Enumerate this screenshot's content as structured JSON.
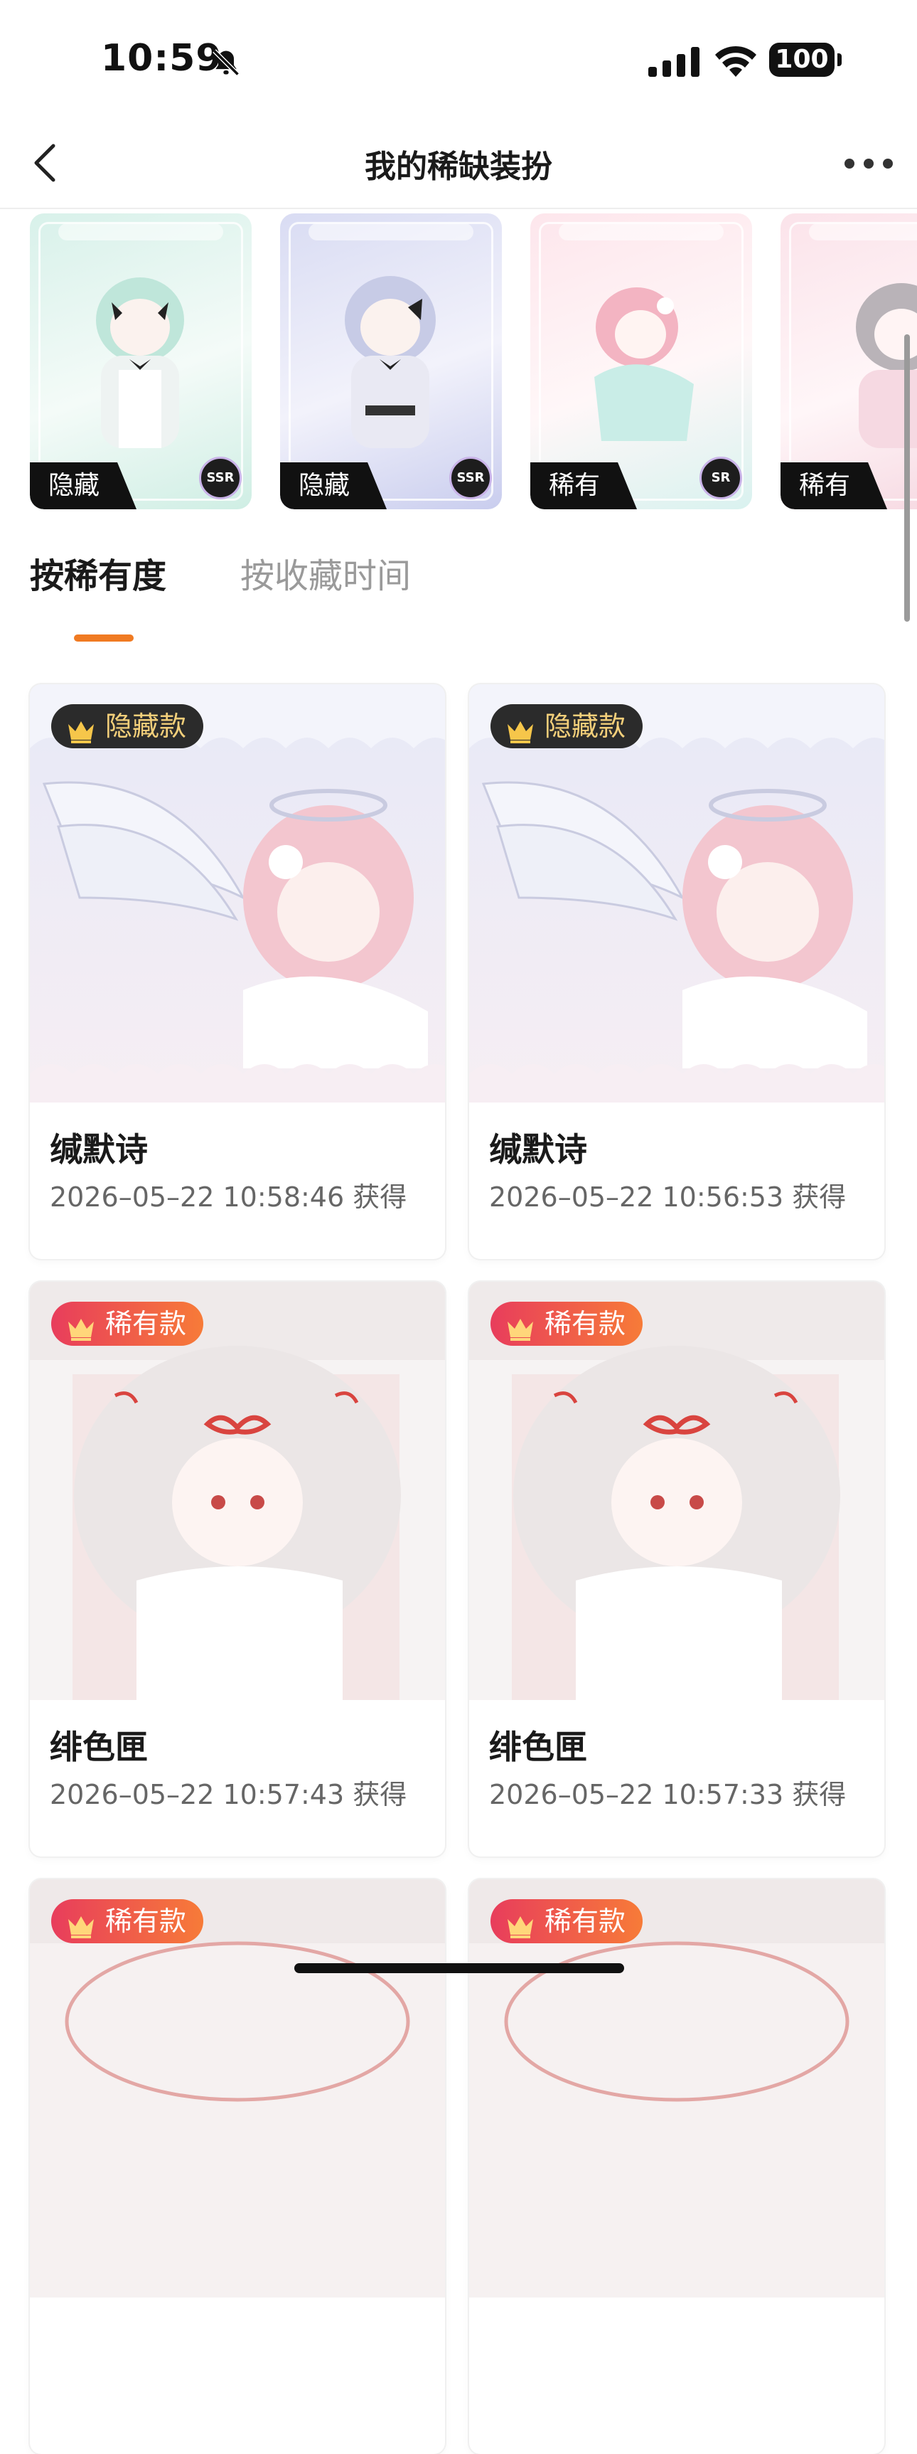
{
  "status": {
    "time": "10:59",
    "battery": "100"
  },
  "nav": {
    "title": "我的稀缺装扮"
  },
  "strip": {
    "cards": [
      {
        "label": "隐藏",
        "rank": "SSR",
        "tone": "#dff3ee"
      },
      {
        "label": "隐藏",
        "rank": "SSR",
        "tone": "#e2e4f6"
      },
      {
        "label": "稀有",
        "rank": "SR",
        "tone": "#fbe4ea"
      },
      {
        "label": "稀有",
        "rank": "",
        "tone": "#fbe8ee"
      }
    ]
  },
  "tabs": [
    {
      "label": "按稀有度"
    },
    {
      "label": "按收藏时间"
    }
  ],
  "items": [
    {
      "tag": "隐藏款",
      "name": "缄默诗",
      "date": "2026–05–22 10:58:46 获得"
    },
    {
      "tag": "隐藏款",
      "name": "缄默诗",
      "date": "2026–05–22 10:56:53 获得"
    },
    {
      "tag": "稀有款",
      "name": "绯色匣",
      "date": "2026–05–22 10:57:43 获得"
    },
    {
      "tag": "稀有款",
      "name": "绯色匣",
      "date": "2026–05–22 10:57:33 获得"
    },
    {
      "tag": "稀有款"
    },
    {
      "tag": "稀有款"
    }
  ],
  "colors": {
    "accent": "#f07a22",
    "hidden_tag_text": "#f3cf7a",
    "rare_tag_from": "#e83d5c",
    "rare_tag_to": "#f77b38"
  }
}
